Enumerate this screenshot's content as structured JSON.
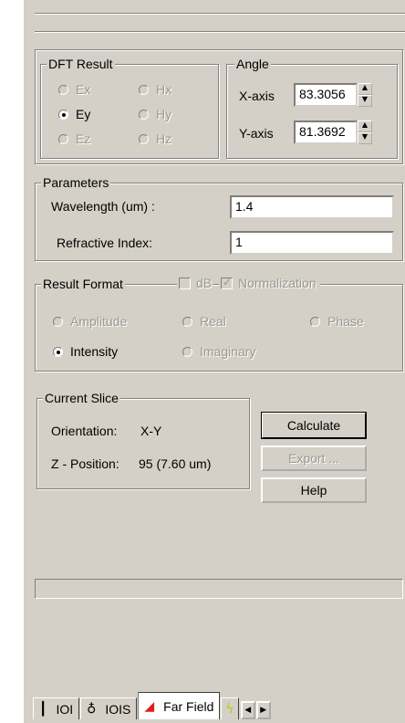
{
  "dft": {
    "legend": "DFT Result",
    "options": [
      {
        "label": "Ex",
        "enabled": false,
        "selected": false
      },
      {
        "label": "Hx",
        "enabled": false,
        "selected": false
      },
      {
        "label": "Ey",
        "enabled": true,
        "selected": true
      },
      {
        "label": "Hy",
        "enabled": false,
        "selected": false
      },
      {
        "label": "Ez",
        "enabled": false,
        "selected": false
      },
      {
        "label": "Hz",
        "enabled": false,
        "selected": false
      }
    ]
  },
  "angle": {
    "legend": "Angle",
    "x_label": "X-axis",
    "x_value": "83.3056",
    "y_label": "Y-axis",
    "y_value": "81.3692"
  },
  "parameters": {
    "legend": "Parameters",
    "wavelength_label": "Wavelength (um) :",
    "wavelength_value": "1.4",
    "refractive_label": "Refractive Index:",
    "refractive_value": "1"
  },
  "result_format": {
    "legend": "Result Format",
    "db_label": "dB",
    "db_checked": false,
    "norm_label": "Normalization",
    "norm_checked": true,
    "amplitude": "Amplitude",
    "real": "Real",
    "phase": "Phase",
    "intensity": "Intensity",
    "imaginary": "Imaginary",
    "selected": "Intensity"
  },
  "slice": {
    "legend": "Current Slice",
    "orientation_label": "Orientation:",
    "orientation_value": "X-Y",
    "z_label": "Z - Position:",
    "z_value": "95 (7.60 um)"
  },
  "buttons": {
    "calculate": "Calculate",
    "export": "Export ...",
    "help": "Help"
  },
  "progress": 0,
  "tabs": [
    {
      "label": "IOI",
      "icon": "antenna-icon"
    },
    {
      "label": "IOIS",
      "icon": "probe-icon"
    },
    {
      "label": "Far Field",
      "icon": "far-field-icon",
      "active": true
    },
    {
      "label": "",
      "icon": "lightning-icon"
    }
  ]
}
